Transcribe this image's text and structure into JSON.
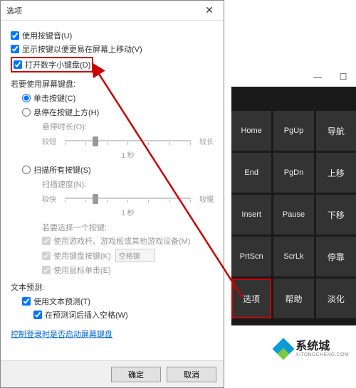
{
  "dialog": {
    "title": "选项",
    "checkboxes": {
      "click_sound": "使用按键音(U)",
      "move_easier": "显示按键以便更易在屏幕上移动(V)",
      "numpad": "打开数字小键盘(D)"
    },
    "section_use_osk": "若要使用屏幕键盘:",
    "radio_click": "单击按键(C)",
    "radio_hover": "悬停在按键上方(H)",
    "hover_time_label": "悬停时长(O):",
    "slider_short": "较短",
    "slider_long": "较长",
    "slider_unit": "1 秒",
    "radio_scan": "扫描所有按键(S)",
    "scan_speed_label": "扫描速度(N):",
    "slider_fast": "较快",
    "slider_slow": "较慢",
    "select_key_label": "若要选择一个按键:",
    "joy_check": "使用游戏杆、游戏板或其他游戏设备(M)",
    "kbkey_check": "使用键盘按键(K)",
    "kbkey_select": "空格键",
    "mouse_check": "使用鼠标单击(E)",
    "text_predict": "文本预测:",
    "use_predict": "使用文本预测(T)",
    "predict_space": "在预测词后插入空格(W)",
    "logon_link": "控制登录时是否启动屏幕键盘",
    "ok": "确定",
    "cancel": "取消"
  },
  "osk": {
    "keys": [
      "Home",
      "PgUp",
      "导航",
      "End",
      "PgDn",
      "上移",
      "Insert",
      "Pause",
      "下移",
      "PrtScn",
      "ScrLk",
      "停靠",
      "选项",
      "帮助",
      "淡化"
    ]
  },
  "watermark": {
    "cn": "系统城",
    "en": "XITONGCHENG.COM"
  }
}
